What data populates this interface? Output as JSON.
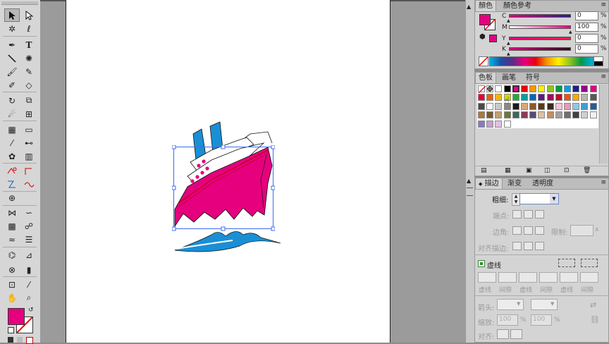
{
  "color_panel": {
    "tabs": [
      "顏色",
      "顏色參考"
    ],
    "channels": [
      {
        "name": "C",
        "value": "0",
        "unit": "%",
        "percent": 0
      },
      {
        "name": "M",
        "value": "100",
        "unit": "%",
        "percent": 100
      },
      {
        "name": "Y",
        "value": "0",
        "unit": "%",
        "percent": 0
      },
      {
        "name": "K",
        "value": "0",
        "unit": "%",
        "percent": 0
      }
    ],
    "fill_color": "#e6007e"
  },
  "swatches_panel": {
    "tabs": [
      "色板",
      "画笔",
      "符号"
    ]
  },
  "stroke_panel": {
    "tabs": [
      "描边",
      "渐变",
      "透明度"
    ],
    "weight_label": "粗细:",
    "cap_label": "端点:",
    "corner_label": "边角:",
    "limit_label": "限制:",
    "align_label": "对齐描边:",
    "dashed_label": "虚线",
    "dash_labels": [
      "虚线",
      "间隙",
      "虚线",
      "间隙",
      "虚线",
      "间隙"
    ],
    "arrow_label": "箭头:",
    "scale_label": "缩放:",
    "scale_start": "100",
    "scale_end": "100",
    "scale_unit": "%",
    "align_arrow_label": "对齐:"
  },
  "toolbar": {
    "fill_color": "#e6007e",
    "tools": [
      "selection",
      "direct-selection",
      "magic-wand",
      "lasso",
      "pen",
      "type",
      "line",
      "rectangle",
      "paintbrush",
      "pencil",
      "blob-brush",
      "eraser",
      "rotate",
      "scale",
      "warp",
      "free-transform",
      "shape-builder",
      "perspective",
      "mesh",
      "gradient",
      "eyedropper",
      "blend",
      "symbol-sprayer",
      "column-graph",
      "artboard",
      "slice",
      "hand",
      "zoom"
    ]
  },
  "artwork": {
    "colors": {
      "magenta": "#e6007e",
      "blue": "#1a8fd6",
      "navy": "#1c2a7a"
    }
  }
}
